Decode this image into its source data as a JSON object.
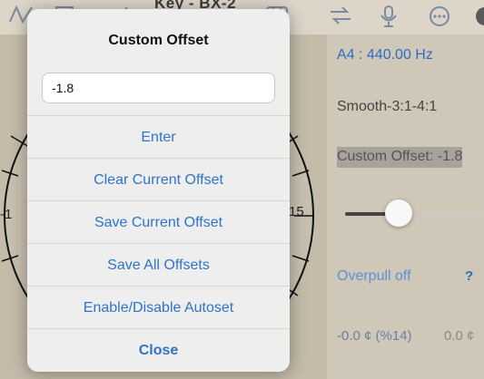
{
  "toolbar": {
    "title_partial": "Key - BX-2",
    "icons": [
      "trace-icon",
      "equalizer-icon",
      "grid-icon",
      "swap-icon",
      "microphone-icon",
      "more-icon"
    ]
  },
  "dial": {
    "left_tick_label": "-1",
    "right_tick_label": "15"
  },
  "right_panel": {
    "pitch": "A4 : 440.00 Hz",
    "temperament": "Smooth-3:1-4:1",
    "custom_offset": "Custom Offset: -1.8",
    "overpull": "Overpull off",
    "help": "?",
    "cents_readout": "-0.0 ¢ (%14)",
    "cents_readout_2": "0.0 ¢"
  },
  "popup": {
    "title": "Custom Offset",
    "input_value": "-1.8",
    "items": {
      "enter": "Enter",
      "clear": "Clear Current Offset",
      "save_current": "Save Current Offset",
      "save_all": "Save All Offsets",
      "autoset": "Enable/Disable Autoset",
      "close": "Close"
    }
  },
  "colors": {
    "accent": "#2f74c8",
    "panel_bg": "#cfc7b7",
    "popup_bg": "#eeeeee"
  }
}
